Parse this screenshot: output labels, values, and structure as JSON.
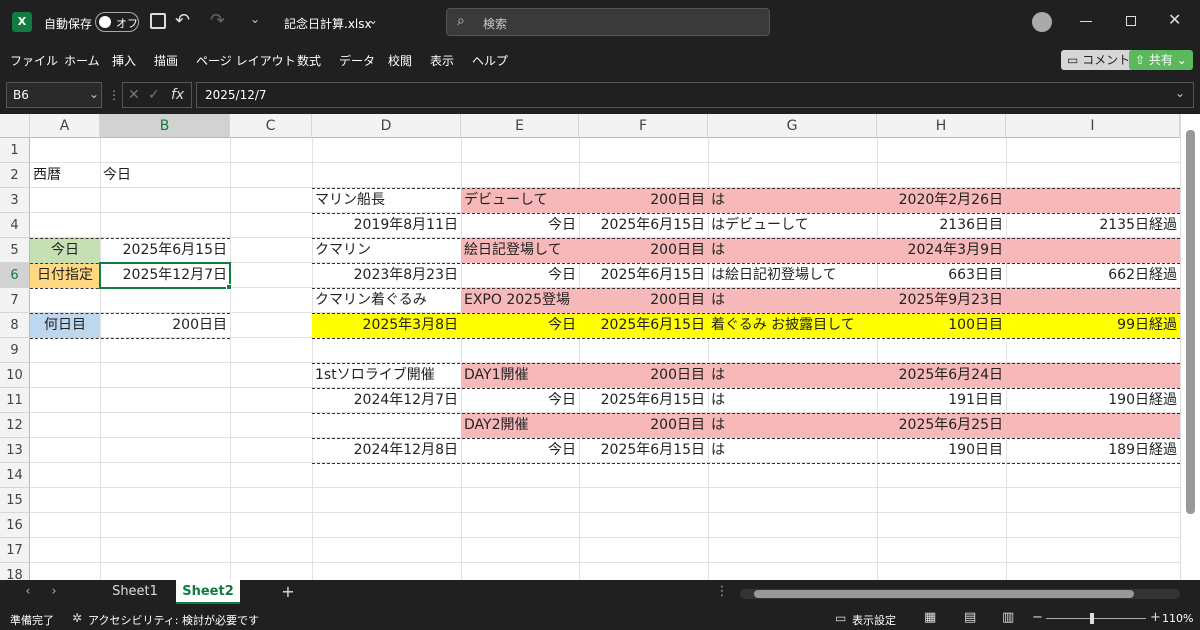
{
  "titlebar": {
    "app_icon": "X",
    "autosave_label": "自動保存",
    "autosave_state": "オフ",
    "filename": "記念日計算.xlsx",
    "search_placeholder": "検索"
  },
  "menu": [
    "ファイル",
    "ホーム",
    "挿入",
    "描画",
    "ページ レイアウト",
    "数式",
    "データ",
    "校閲",
    "表示",
    "ヘルプ"
  ],
  "buttons": {
    "comment": "コメント",
    "share": "共有"
  },
  "formula_bar": {
    "name_box": "B6",
    "fx": "fx",
    "value": "2025/12/7"
  },
  "columns": [
    "A",
    "B",
    "C",
    "D",
    "E",
    "F",
    "G",
    "H",
    "I"
  ],
  "rows": [
    "1",
    "2",
    "3",
    "4",
    "5",
    "6",
    "7",
    "8",
    "9",
    "10",
    "11",
    "12",
    "13",
    "14",
    "15",
    "16",
    "17",
    "18"
  ],
  "cells": {
    "A2": "西暦",
    "B2": "今日",
    "A5": "今日",
    "B5": "2025年6月15日",
    "A6": "日付指定",
    "B6": "2025年12月7日",
    "A8": "何日目",
    "B8": "200日目",
    "D3": "マリン船長",
    "E3": "デビューして",
    "F3": "200日目",
    "G3": "は",
    "H3": "2020年2月26日",
    "D4": "2019年8月11日",
    "E4": "今日",
    "F4": "2025年6月15日",
    "G4": "はデビューして",
    "H4": "2136日目",
    "I4": "2135日経過",
    "D5": "クマリン",
    "E5": "絵日記登場して",
    "F5": "200日目",
    "G5": "は",
    "H5": "2024年3月9日",
    "D6": "2023年8月23日",
    "E6": "今日",
    "F6": "2025年6月15日",
    "G6": "は絵日記初登場して",
    "H6": "663日目",
    "I6": "662日経過",
    "D7": "クマリン着ぐるみ",
    "E7": "EXPO 2025登場",
    "F7": "200日目",
    "G7": "は",
    "H7": "2025年9月23日",
    "D8": "2025年3月8日",
    "E8": "今日",
    "F8": "2025年6月15日",
    "G8": "着ぐるみ お披露目して",
    "H8": "100日目",
    "I8": "99日経過",
    "D10": "1stソロライブ開催",
    "E10": "DAY1開催",
    "F10": "200日目",
    "G10": "は",
    "H10": "2025年6月24日",
    "D11": "2024年12月7日",
    "E11": "今日",
    "F11": "2025年6月15日",
    "G11": "は",
    "H11": "191日目",
    "I11": "190日経過",
    "E12": "DAY2開催",
    "F12": "200日目",
    "G12": "は",
    "H12": "2025年6月25日",
    "D13": "2024年12月8日",
    "E13": "今日",
    "F13": "2025年6月15日",
    "G13": "は",
    "H13": "190日目",
    "I13": "189日経過"
  },
  "sheets": {
    "sheet1": "Sheet1",
    "sheet2": "Sheet2",
    "add": "+"
  },
  "status": {
    "ready": "準備完了",
    "accessibility": "アクセシビリティ: 検討が必要です",
    "display_settings": "表示設定",
    "zoom": "110%"
  },
  "colors": {
    "pink": "#f6b8b8",
    "yellow": "#ffff00",
    "green": "#c6e0b4",
    "orange": "#ffd880",
    "blue": "#bdd7ee",
    "excel_green": "#107c41"
  }
}
